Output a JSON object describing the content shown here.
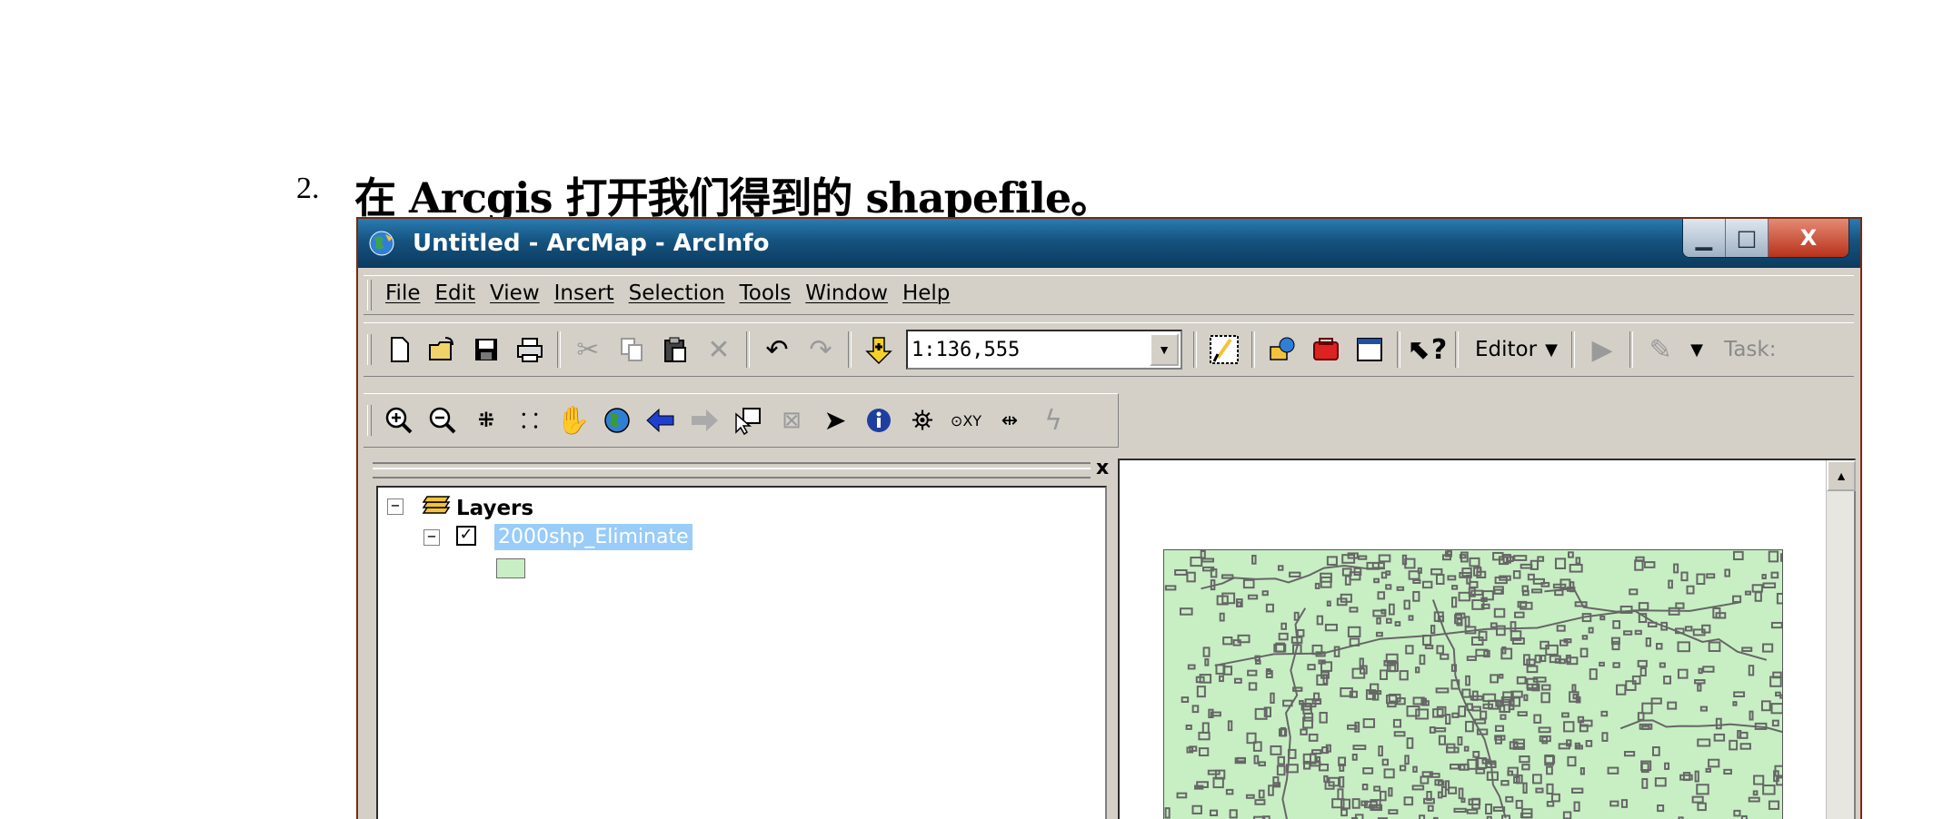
{
  "document": {
    "step_number": "2.",
    "heading": "在 Arcgis 打开我们得到的 shapefile。"
  },
  "window": {
    "title": "Untitled - ArcMap - ArcInfo",
    "controls": {
      "minimize": "▁",
      "maximize": "□",
      "close": "X"
    }
  },
  "menu": {
    "items": [
      "File",
      "Edit",
      "View",
      "Insert",
      "Selection",
      "Tools",
      "Window",
      "Help"
    ]
  },
  "standard_toolbar": {
    "scale_value": "1:136,555",
    "editor_label": "Editor",
    "task_label": "Task:"
  },
  "toc": {
    "close_symbol": "x",
    "root_label": "Layers",
    "layer_name": "2000shp_Eliminate",
    "layer_visible": true,
    "layer_fill_color": "#c8efc4"
  },
  "map": {
    "fill_color": "#c8efc4",
    "outline_color": "#666666"
  }
}
